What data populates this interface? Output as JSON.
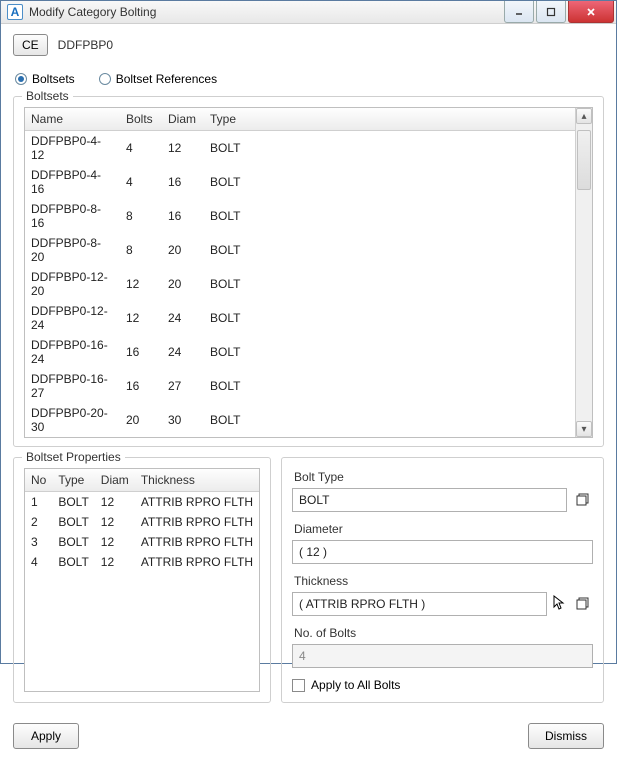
{
  "window": {
    "title": "Modify Category Bolting"
  },
  "ce": {
    "button_label": "CE",
    "name": "DDFPBP0"
  },
  "radios": {
    "boltsets_label": "Boltsets",
    "boltset_refs_label": "Boltset References",
    "selected": "boltsets"
  },
  "boltsets": {
    "group_label": "Boltsets",
    "headers": {
      "name": "Name",
      "bolts": "Bolts",
      "diam": "Diam",
      "type": "Type"
    },
    "rows": [
      {
        "name": "DDFPBP0-4-12",
        "bolts": "4",
        "diam": "12",
        "type": "BOLT"
      },
      {
        "name": "DDFPBP0-4-16",
        "bolts": "4",
        "diam": "16",
        "type": "BOLT"
      },
      {
        "name": "DDFPBP0-8-16",
        "bolts": "8",
        "diam": "16",
        "type": "BOLT"
      },
      {
        "name": "DDFPBP0-8-20",
        "bolts": "8",
        "diam": "20",
        "type": "BOLT"
      },
      {
        "name": "DDFPBP0-12-20",
        "bolts": "12",
        "diam": "20",
        "type": "BOLT"
      },
      {
        "name": "DDFPBP0-12-24",
        "bolts": "12",
        "diam": "24",
        "type": "BOLT"
      },
      {
        "name": "DDFPBP0-16-24",
        "bolts": "16",
        "diam": "24",
        "type": "BOLT"
      },
      {
        "name": "DDFPBP0-16-27",
        "bolts": "16",
        "diam": "27",
        "type": "BOLT"
      },
      {
        "name": "DDFPBP0-20-30",
        "bolts": "20",
        "diam": "30",
        "type": "BOLT"
      }
    ]
  },
  "props": {
    "group_label": "Boltset Properties",
    "headers": {
      "no": "No",
      "type": "Type",
      "diam": "Diam",
      "thickness": "Thickness"
    },
    "rows": [
      {
        "no": "1",
        "type": "BOLT",
        "diam": "12",
        "thickness": "ATTRIB RPRO FLTH"
      },
      {
        "no": "2",
        "type": "BOLT",
        "diam": "12",
        "thickness": "ATTRIB RPRO FLTH"
      },
      {
        "no": "3",
        "type": "BOLT",
        "diam": "12",
        "thickness": "ATTRIB RPRO FLTH"
      },
      {
        "no": "4",
        "type": "BOLT",
        "diam": "12",
        "thickness": "ATTRIB RPRO FLTH"
      }
    ]
  },
  "form": {
    "bolt_type_label": "Bolt Type",
    "bolt_type_value": "BOLT",
    "diameter_label": "Diameter",
    "diameter_value": "( 12 )",
    "thickness_label": "Thickness",
    "thickness_value": "( ATTRIB RPRO FLTH )",
    "no_bolts_label": "No. of Bolts",
    "no_bolts_value": "4",
    "apply_all_label": "Apply to All Bolts",
    "apply_all_checked": false
  },
  "footer": {
    "apply_label": "Apply",
    "dismiss_label": "Dismiss"
  }
}
